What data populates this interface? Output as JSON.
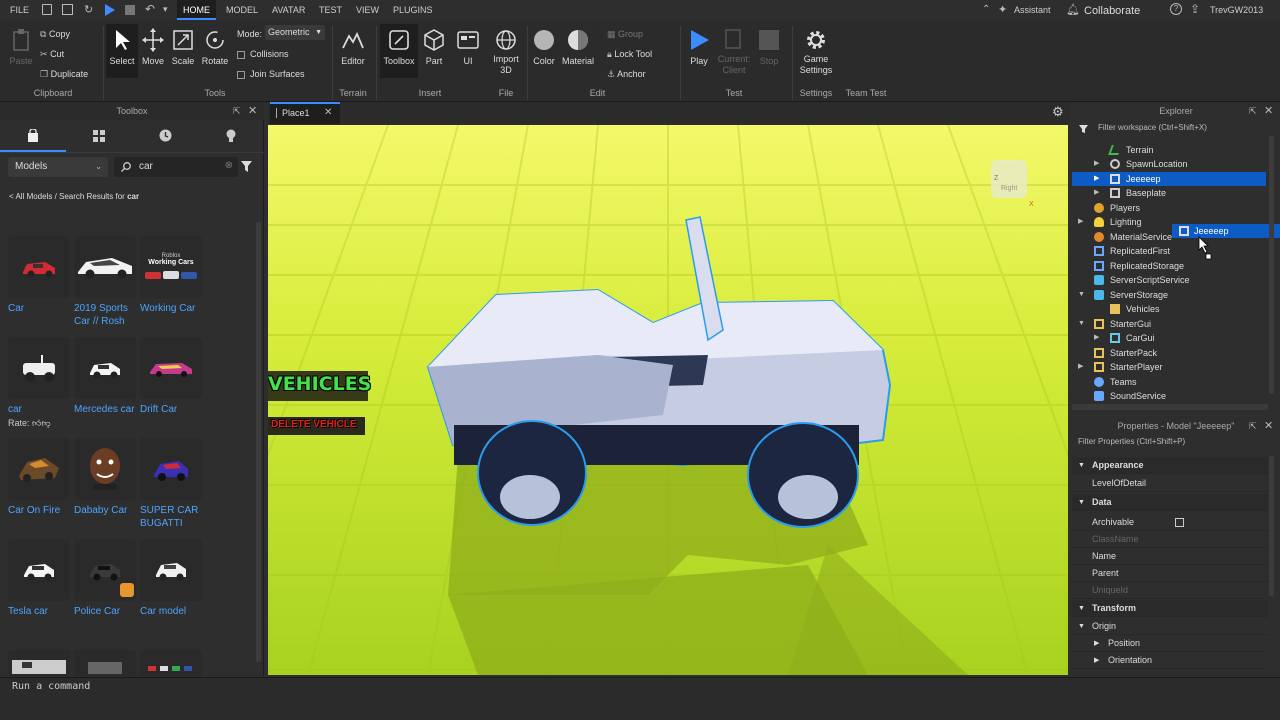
{
  "menu": {
    "file": "FILE",
    "tabs": [
      "HOME",
      "MODEL",
      "AVATAR",
      "TEST",
      "VIEW",
      "PLUGINS"
    ],
    "assistant": "Assistant",
    "collaborate": "Collaborate",
    "user": "TrevGW2013"
  },
  "ribbon": {
    "paste": "Paste",
    "copy": "Copy",
    "cut": "Cut",
    "duplicate": "Duplicate",
    "clipboard": "Clipboard",
    "select": "Select",
    "move": "Move",
    "scale": "Scale",
    "rotate": "Rotate",
    "mode_label": "Mode:",
    "mode_value": "Geometric",
    "collisions": "Collisions",
    "join_surfaces": "Join Surfaces",
    "tools": "Tools",
    "editor": "Editor",
    "terrain": "Terrain",
    "toolbox": "Toolbox",
    "part": "Part",
    "ui": "UI",
    "import3d_1": "Import",
    "import3d_2": "3D",
    "insert": "Insert",
    "file": "File",
    "color": "Color",
    "material": "Material",
    "group": "Group",
    "lock_tool": "Lock Tool",
    "anchor": "Anchor",
    "edit": "Edit",
    "play": "Play",
    "current_client_1": "Current:",
    "current_client_2": "Client",
    "stop": "Stop",
    "test": "Test",
    "game_settings_1": "Game",
    "game_settings_2": "Settings",
    "settings": "Settings",
    "team_test": "Team Test"
  },
  "toolbox": {
    "title": "Toolbox",
    "category": "Models",
    "search_value": "car",
    "breadcrumb_prefix": "< All Models / Search Results for ",
    "breadcrumb_term": "car",
    "rate_label": "Rate:",
    "assets": [
      {
        "name": "Car"
      },
      {
        "name": "2019 Sports Car // Rosh"
      },
      {
        "name": "Working Car"
      },
      {
        "name": "car"
      },
      {
        "name": "Mercedes car"
      },
      {
        "name": "Drift Car"
      },
      {
        "name": "Car On Fire"
      },
      {
        "name": "Dababy Car"
      },
      {
        "name": "SUPER CAR BUGATTI"
      },
      {
        "name": "Tesla car"
      },
      {
        "name": "Police Car"
      },
      {
        "name": "Car model"
      }
    ],
    "thumb_texts": {
      "working_1": "Roblox",
      "working_2": "Working Cars"
    }
  },
  "viewport": {
    "tab": "Place1",
    "vehicles_label": "VEHICLES",
    "delete_label": "DELETE VEHICLE",
    "cube_label": "Right",
    "axis_z": "Z",
    "axis_x": "X"
  },
  "explorer": {
    "title": "Explorer",
    "filter": "Filter workspace (Ctrl+Shift+X)",
    "items": [
      {
        "label": "Terrain",
        "icon_color": "#3fb950"
      },
      {
        "label": "SpawnLocation",
        "icon_color": "#cccccc"
      },
      {
        "label": "Jeeeeep",
        "icon_color": "#dddddd"
      },
      {
        "label": "Baseplate",
        "icon_color": "#cccccc"
      },
      {
        "label": "Players",
        "icon_color": "#e0a030"
      },
      {
        "label": "Lighting",
        "icon_color": "#f2d13a"
      },
      {
        "label": "MaterialService",
        "icon_color": "#e08a30"
      },
      {
        "label": "ReplicatedFirst",
        "icon_color": "#6aa7ff"
      },
      {
        "label": "ReplicatedStorage",
        "icon_color": "#6aa7ff"
      },
      {
        "label": "ServerScriptService",
        "icon_color": "#4ab8e8"
      },
      {
        "label": "ServerStorage",
        "icon_color": "#4ab8e8"
      },
      {
        "label": "Vehicles",
        "icon_color": "#e8c35a"
      },
      {
        "label": "StarterGui",
        "icon_color": "#e8c35a"
      },
      {
        "label": "CarGui",
        "icon_color": "#6ac7e8"
      },
      {
        "label": "StarterPack",
        "icon_color": "#e8c35a"
      },
      {
        "label": "StarterPlayer",
        "icon_color": "#e8c35a"
      },
      {
        "label": "Teams",
        "icon_color": "#6aa7ff"
      },
      {
        "label": "SoundService",
        "icon_color": "#6aa7ff"
      }
    ],
    "drag_label": "Jeeeeep"
  },
  "properties": {
    "title": "Properties - Model \"Jeeeeep\"",
    "filter": "Filter Properties (Ctrl+Shift+P)",
    "rows": [
      {
        "label": "Appearance"
      },
      {
        "label": "LevelOfDetail"
      },
      {
        "label": "Data"
      },
      {
        "label": "Archivable"
      },
      {
        "label": "ClassName"
      },
      {
        "label": "Name"
      },
      {
        "label": "Parent"
      },
      {
        "label": "UniqueId"
      },
      {
        "label": "Transform"
      },
      {
        "label": "Origin"
      },
      {
        "label": "Position"
      },
      {
        "label": "Orientation"
      }
    ]
  },
  "command": {
    "placeholder": "Run a command"
  },
  "colors": {
    "accent": "#3c8cff",
    "selection": "#0d5bc4",
    "link": "#4da3ff",
    "baseplate": "#cde833"
  }
}
